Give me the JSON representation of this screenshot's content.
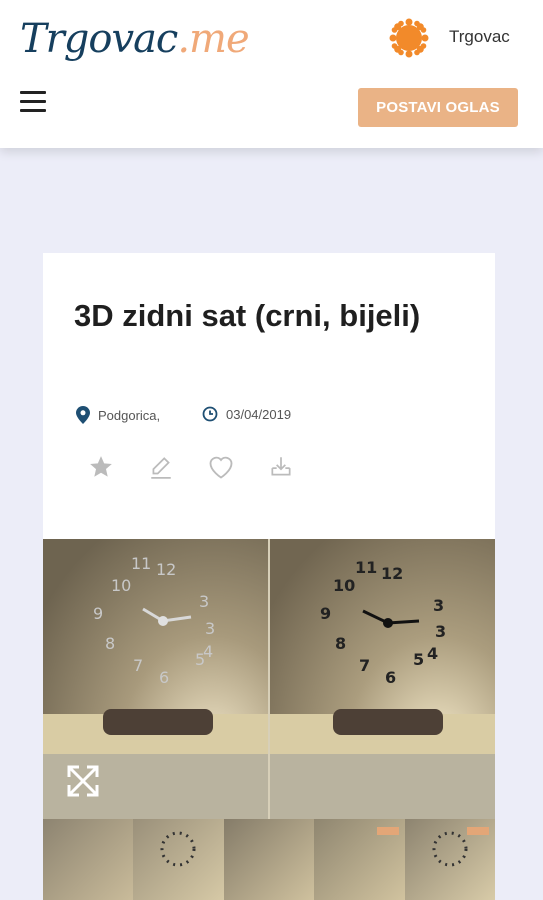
{
  "header": {
    "logo_main": "Trgovac",
    "logo_suffix": ".me",
    "username": "Trgovac",
    "post_button": "POSTAVI OGLAS"
  },
  "listing": {
    "title": "3D zidni sat (crni, bijeli)",
    "location": "Podgorica,",
    "date": "03/04/2019"
  },
  "actions": {
    "icons": [
      "star-icon",
      "edit-icon",
      "heart-icon",
      "download-icon"
    ]
  },
  "gallery": {
    "main_image": "3D wall clock photo, silver and black variants",
    "thumbnail_count": 5
  },
  "colors": {
    "brand_dark": "#163f5e",
    "brand_accent": "#f0a979",
    "button": "#eab386",
    "background": "#ecedf8"
  }
}
